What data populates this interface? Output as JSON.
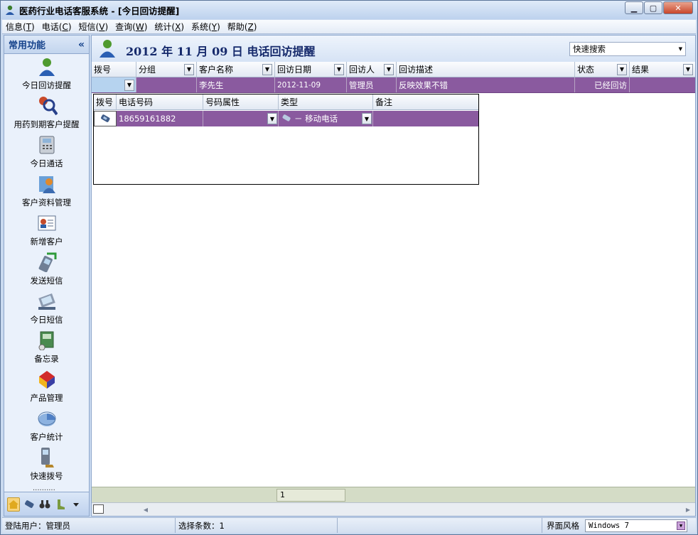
{
  "window": {
    "title": "医药行业电话客服系统 - [今日回访提醒]"
  },
  "menu": [
    {
      "label": "信息",
      "key": "T"
    },
    {
      "label": "电话",
      "key": "C"
    },
    {
      "label": "短信",
      "key": "V"
    },
    {
      "label": "查询",
      "key": "W"
    },
    {
      "label": "统计",
      "key": "X"
    },
    {
      "label": "系统",
      "key": "Y"
    },
    {
      "label": "帮助",
      "key": "Z"
    }
  ],
  "sidebar": {
    "title": "常用功能",
    "collapse": "«",
    "items": [
      {
        "label": "今日回访提醒",
        "icon": "user-reminder-icon"
      },
      {
        "label": "用药到期客户提醒",
        "icon": "magnifier-user-icon"
      },
      {
        "label": "今日通话",
        "icon": "telephone-icon"
      },
      {
        "label": "客户资料管理",
        "icon": "customer-file-icon"
      },
      {
        "label": "新增客户",
        "icon": "add-contact-card-icon"
      },
      {
        "label": "发送短信",
        "icon": "send-sms-icon"
      },
      {
        "label": "今日短信",
        "icon": "sms-device-icon"
      },
      {
        "label": "备忘录",
        "icon": "memo-icon"
      },
      {
        "label": "产品管理",
        "icon": "product-boxes-icon"
      },
      {
        "label": "客户统计",
        "icon": "pie-chart-icon"
      },
      {
        "label": "快速拨号",
        "icon": "quick-dial-icon"
      }
    ],
    "dots": "..........",
    "footer_icons": [
      "home-icon",
      "phone-handset-icon",
      "binoculars-icon",
      "boot-icon",
      "more-arrow-icon"
    ]
  },
  "header": {
    "title": "2012 年 11 月 09 日  电话回访提醒",
    "search_label": "快速搜索"
  },
  "grid": {
    "columns": [
      "拨号",
      "分组",
      "客户名称",
      "回访日期",
      "回访人",
      "回访描述",
      "状态",
      "结果"
    ],
    "row": {
      "dial": "",
      "group": "",
      "name": "李先生",
      "date": "2012-11-09",
      "visitor": "管理员",
      "description": "反映效果不错",
      "status": "已经回访",
      "result": ""
    }
  },
  "detail": {
    "columns": [
      "拨号",
      "电话号码",
      "号码属性",
      "类型",
      "备注"
    ],
    "row": {
      "phone": "18659161882",
      "attribute": "",
      "type": "－ 移动电话",
      "note": ""
    }
  },
  "pager": {
    "page": "1"
  },
  "status": {
    "user": "登陆用户：管理员",
    "selected": "选择条数：1",
    "style_label": "界面风格",
    "style_value": "Windows 7"
  }
}
